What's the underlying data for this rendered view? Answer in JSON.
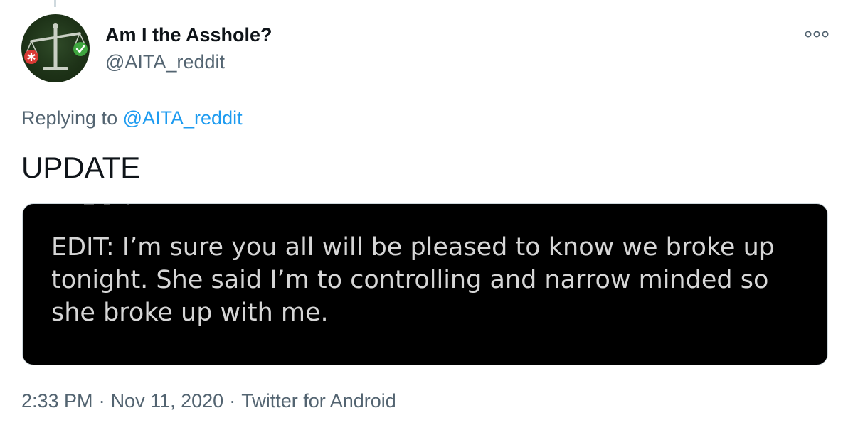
{
  "tweet": {
    "author": {
      "display_name": "Am I the Asshole?",
      "handle": "@AITA_reddit",
      "avatar_icon": "scales-of-justice-icon"
    },
    "replying_prefix": "Replying to",
    "replying_to": "@AITA_reddit",
    "text": "UPDATE",
    "media": {
      "text": "EDIT: I’m sure you all will be pleased to know we broke up tonight. She said I’m to controlling and narrow minded so she broke up with me."
    },
    "meta": {
      "time": "2:33 PM",
      "separator": "·",
      "date": "Nov 11, 2020",
      "source": "Twitter for Android"
    },
    "more_icon": "more-options-icon"
  },
  "colors": {
    "link": "#1d9bf0",
    "secondary_text": "#536471",
    "avatar_bg": "#1e3318",
    "red_badge": "#d93a35",
    "green_badge": "#3fa63f"
  }
}
